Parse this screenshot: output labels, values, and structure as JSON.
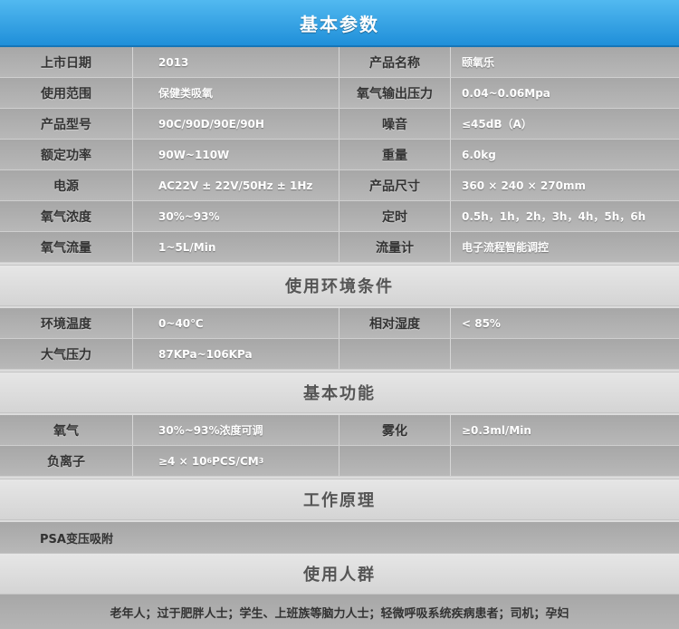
{
  "header": {
    "title": "基本参数"
  },
  "basic_params": [
    {
      "label1": "上市日期",
      "value1": "2013",
      "label2": "产品名称",
      "value2": "颐氧乐"
    },
    {
      "label1": "使用范围",
      "value1": "保健类吸氧",
      "label2": "氧气输出压力",
      "value2": "0.04~0.06Mpa"
    },
    {
      "label1": "产品型号",
      "value1": "90C/90D/90E/90H",
      "label2": "噪音",
      "value2": "≤45dB（A）"
    },
    {
      "label1": "额定功率",
      "value1": "90W~110W",
      "label2": "重量",
      "value2": "6.0kg"
    },
    {
      "label1": "电源",
      "value1": "AC22V ± 22V/50Hz ± 1Hz",
      "label2": "产品尺寸",
      "value2": "360 × 240 × 270mm"
    },
    {
      "label1": "氧气浓度",
      "value1": "30%~93%",
      "label2": "定时",
      "value2": "0.5h，1h，2h，3h，4h，5h，6h"
    },
    {
      "label1": "氧气流量",
      "value1": "1~5L/Min",
      "label2": "流量计",
      "value2": "电子流程智能调控"
    }
  ],
  "env_section": {
    "title": "使用环境条件"
  },
  "env_params": [
    {
      "label1": "环境温度",
      "value1": "0~40℃",
      "label2": "相对湿度",
      "value2": "< 85%"
    },
    {
      "label1": "大气压力",
      "value1": "87KPa~106KPa",
      "label2": "",
      "value2": ""
    }
  ],
  "func_section": {
    "title": "基本功能"
  },
  "func_params": [
    {
      "label1": "氧气",
      "value1": "30%~93%浓度可调",
      "label2": "雾化",
      "value2": "≥0.3ml/Min"
    },
    {
      "label1": "负离子",
      "value1_prefix": "≥4 × 10",
      "value1_sup": "6",
      "value1_mid": " PCS/CM",
      "value1_sup2": "3",
      "label2": "",
      "value2": ""
    }
  ],
  "principle_section": {
    "title": "工作原理",
    "text": "PSA变压吸附"
  },
  "people_section": {
    "title": "使用人群",
    "text": "老年人；过于肥胖人士；学生、上班族等脑力人士；轻微呼吸系统疾病患者；司机；孕妇"
  }
}
